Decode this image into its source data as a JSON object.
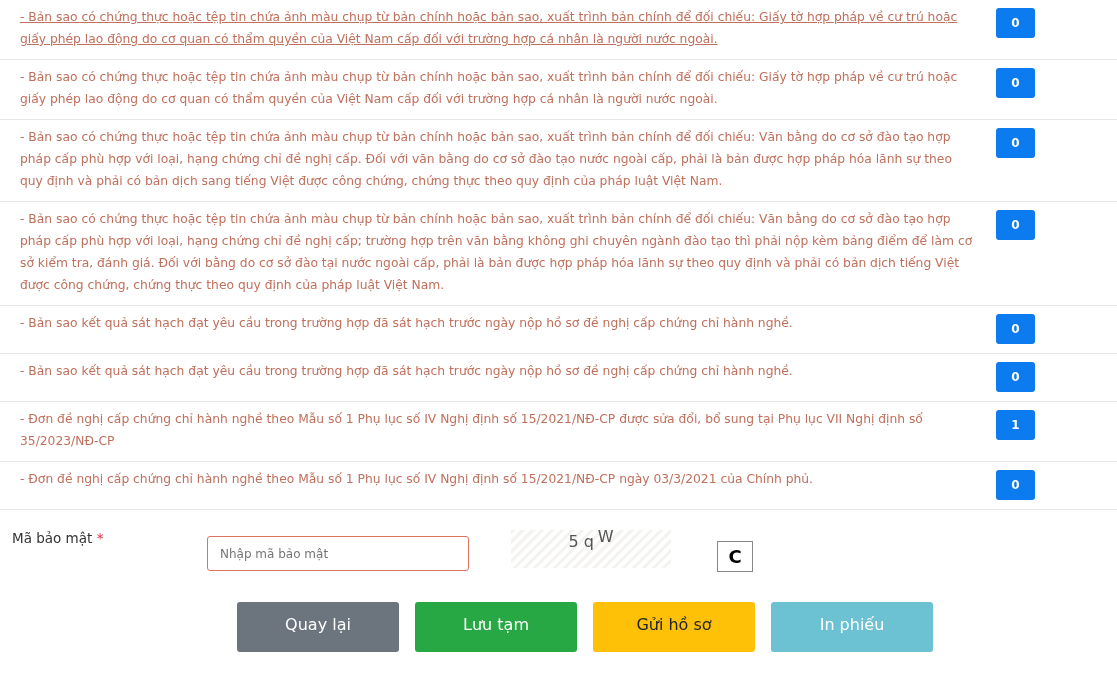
{
  "documents": [
    {
      "text": "- Bản sao có chứng thực hoặc tệp tin chứa ảnh màu chụp từ bản chính hoặc bản sao, xuất trình bản chính để đối chiếu: Giấy tờ hợp pháp về cư trú hoặc giấy phép lao động do cơ quan có thẩm quyền của Việt Nam cấp đối với trường hợp cá nhân là người nước ngoài.",
      "underlined": true,
      "count": "0"
    },
    {
      "text": "- Bản sao có chứng thực hoặc tệp tin chứa ảnh màu chụp từ bản chính hoặc bản sao, xuất trình bản chính để đối chiếu: Giấy tờ hợp pháp về cư trú hoặc giấy phép lao động do cơ quan có thẩm quyền của Việt Nam cấp đối với trường hợp cá nhân là người nước ngoài.",
      "underlined": false,
      "count": "0"
    },
    {
      "text": "- Bản sao có chứng thực hoặc tệp tin chứa ảnh màu chụp từ bản chính hoặc bản sao, xuất trình bản chính để đối chiếu: Văn bằng do cơ sở đào tạo hợp pháp cấp phù hợp với loại, hạng chứng chỉ đề nghị cấp. Đối với văn bằng do cơ sở đào tạo nước ngoài cấp, phải là bản được hợp pháp hóa lãnh sự theo quy định và phải có bản dịch sang tiếng Việt được công chứng, chứng thực theo quy định của pháp luật Việt Nam.",
      "underlined": false,
      "count": "0"
    },
    {
      "text": "- Bản sao có chứng thực hoặc tệp tin chứa ảnh màu chụp từ bản chính hoặc bản sao, xuất trình bản chính để đối chiếu: Văn bằng do cơ sở đào tạo hợp pháp cấp phù hợp với loại, hạng chứng chỉ đề nghị cấp; trường hợp trên văn bằng không ghi chuyên ngành đào tạo thì phải nộp kèm bảng điểm để làm cơ sở kiểm tra, đánh giá. Đối với bằng do cơ sở đào tại nước ngoài cấp, phải là bản được hợp pháp hóa lãnh sự theo quy định và phải có bản dịch tiếng Việt được công chứng, chứng thực theo quy định của pháp luật Việt Nam.",
      "underlined": false,
      "count": "0"
    },
    {
      "text": "- Bản sao kết quả sát hạch đạt yêu cầu trong trường hợp đã sát hạch trước ngày nộp hồ sơ đề nghị cấp chứng chỉ hành nghề.",
      "underlined": false,
      "count": "0"
    },
    {
      "text": "- Bản sao kết quả sát hạch đạt yêu cầu trong trường hợp đã sát hạch trước ngày nộp hồ sơ đề nghị cấp chứng chỉ hành nghề.",
      "underlined": false,
      "count": "0"
    },
    {
      "text": "- Đơn đề nghị cấp chứng chỉ hành nghề theo Mẫu số 1 Phụ lục số IV Nghị định số 15/2021/NĐ-CP được sửa đổi, bổ sung tại Phụ lục VII Nghị định số 35/2023/NĐ-CP",
      "underlined": false,
      "count": "1"
    },
    {
      "text": "- Đơn đề nghị cấp chứng chỉ hành nghề theo Mẫu số 1 Phụ lục số IV Nghị định số 15/2021/NĐ-CP ngày 03/3/2021 của Chính phủ.",
      "underlined": false,
      "count": "0"
    }
  ],
  "security": {
    "label": "Mã bảo mật",
    "required_mark": "*",
    "placeholder": "Nhập mã bảo mật",
    "captcha": [
      "5 q",
      "W"
    ],
    "refresh": "C"
  },
  "buttons": [
    {
      "label": "Quay lại",
      "kind": "secondary"
    },
    {
      "label": "Lưu tạm",
      "kind": "success"
    },
    {
      "label": "Gửi hồ sơ",
      "kind": "warning"
    },
    {
      "label": "In phiếu",
      "kind": "info"
    }
  ]
}
